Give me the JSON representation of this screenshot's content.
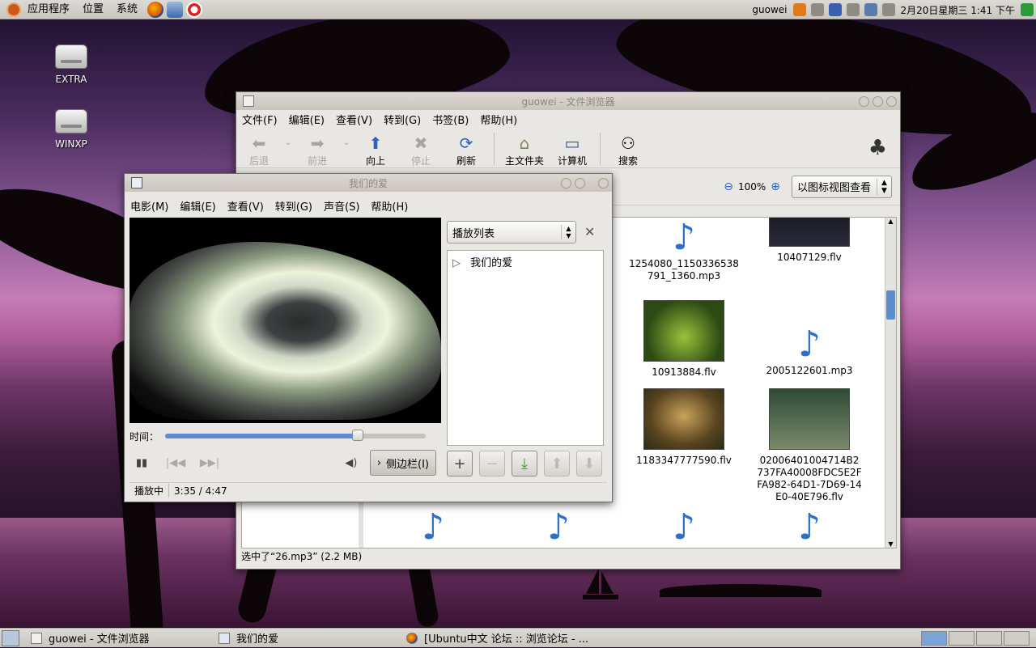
{
  "top_panel": {
    "menus": [
      "应用程序",
      "位置",
      "系统"
    ],
    "user": "guowei",
    "datetime": "2月20日星期三  1:41 下午"
  },
  "desktop_icons": [
    "EXTRA",
    "WINXP"
  ],
  "file_browser": {
    "title": "guowei - 文件浏览器",
    "menu": [
      "文件(F)",
      "编辑(E)",
      "查看(V)",
      "转到(G)",
      "书签(B)",
      "帮助(H)"
    ],
    "toolbar": {
      "back": "后退",
      "forward": "前进",
      "up": "向上",
      "stop": "停止",
      "refresh": "刷新",
      "home": "主文件夹",
      "computer": "计算机",
      "search": "搜索"
    },
    "zoom": "100%",
    "view_mode": "以图标视图查看",
    "files": [
      {
        "name": "1254080_1150336538791_1360.mp3",
        "type": "audio"
      },
      {
        "name": "10407129.flv",
        "type": "video"
      },
      {
        "name": "10913884.flv",
        "type": "video"
      },
      {
        "name": "2005122601.mp3",
        "type": "audio"
      },
      {
        "name": "1183347777590.flv",
        "type": "video"
      },
      {
        "name": "02006401004714B2737FA40008FDC5E2FFA982-64D1-7D69-14E0-40E796.flv",
        "type": "video"
      }
    ],
    "status": "选中了“26.mp3” (2.2 MB)"
  },
  "movie_player": {
    "title": "我们的爱",
    "menu": [
      "电影(M)",
      "编辑(E)",
      "查看(V)",
      "转到(G)",
      "声音(S)",
      "帮助(H)"
    ],
    "time_label": "时间：",
    "progress": 0.74,
    "sidebar_button": "侧边栏(I)",
    "playlist_header": "播放列表",
    "playlist_items": [
      "我们的爱"
    ],
    "status_state": "播放中",
    "status_time": "3:35 / 4:47"
  },
  "taskbar": {
    "tasks": [
      "guowei - 文件浏览器",
      "我们的爱",
      "[Ubuntu中文 论坛 :: 浏览论坛 - ..."
    ]
  }
}
